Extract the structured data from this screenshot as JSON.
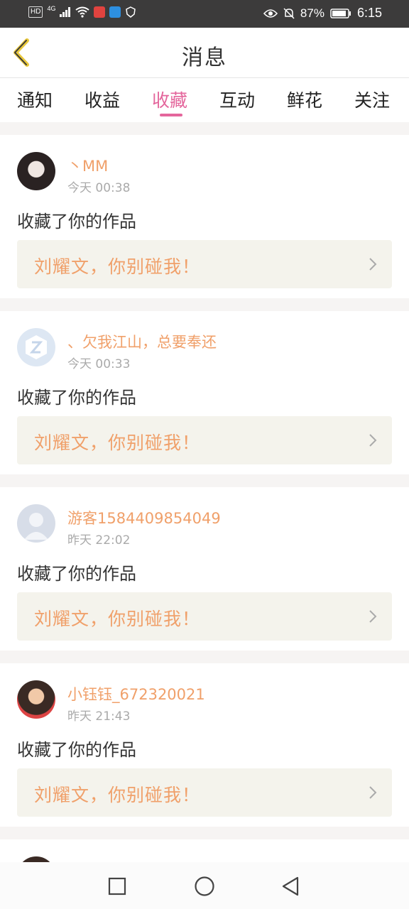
{
  "status_bar": {
    "hd_label": "HD",
    "network": "4G",
    "battery_percent": "87%",
    "time": "6:15"
  },
  "header": {
    "title": "消息"
  },
  "tabs": [
    {
      "label": "通知",
      "active": false
    },
    {
      "label": "收益",
      "active": false
    },
    {
      "label": "收藏",
      "active": true
    },
    {
      "label": "互动",
      "active": false
    },
    {
      "label": "鲜花",
      "active": false
    },
    {
      "label": "关注",
      "active": false
    }
  ],
  "messages": [
    {
      "user": "丶MM",
      "time": "今天 00:38",
      "action": "收藏了你的作品",
      "work_title": "刘耀文，你别碰我！"
    },
    {
      "user": "、欠我江山，总要奉还",
      "time": "今天 00:33",
      "action": "收藏了你的作品",
      "work_title": "刘耀文，你别碰我！"
    },
    {
      "user": "游客1584409854049",
      "time": "昨天 22:02",
      "action": "收藏了你的作品",
      "work_title": "刘耀文，你别碰我！"
    },
    {
      "user": "小钰钰_672320021",
      "time": "昨天 21:43",
      "action": "收藏了你的作品",
      "work_title": "刘耀文，你别碰我！"
    }
  ],
  "colors": {
    "accent": "#e4669c",
    "username": "#f0a06a",
    "status_bar": "#3c3b3b"
  },
  "icons": {
    "back": "back-chevron-icon",
    "row_chevron": "chevron-right-icon",
    "nav": [
      "recents-square-icon",
      "home-circle-icon",
      "back-triangle-icon"
    ]
  }
}
